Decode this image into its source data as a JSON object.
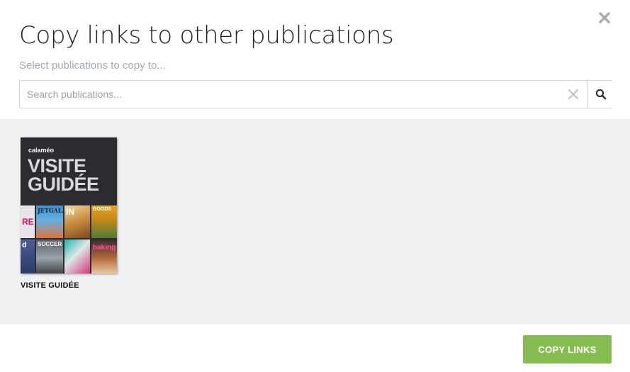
{
  "dialog": {
    "title": "Copy links to other publications",
    "subtitle": "Select publications to copy to...",
    "close_icon": "close-icon"
  },
  "search": {
    "placeholder": "Search publications...",
    "value": "",
    "clear_icon": "clear-icon",
    "search_icon": "search-icon"
  },
  "publications": [
    {
      "label": "VISITE GUIDÉE",
      "cover": {
        "brand": "calaméo",
        "headline_line1": "VISITE",
        "headline_line2": "GUIDÉE",
        "thumbnails": [
          "RE",
          "JETGALA",
          "IN",
          "GOODS",
          "d",
          "SOCCER",
          "",
          "baking"
        ]
      }
    }
  ],
  "footer": {
    "copy_button_label": "COPY LINKS"
  },
  "colors": {
    "accent": "#86bd50",
    "content_bg": "#eff1f3",
    "title": "#1f1f1f",
    "subtitle": "#a3a8ad"
  }
}
